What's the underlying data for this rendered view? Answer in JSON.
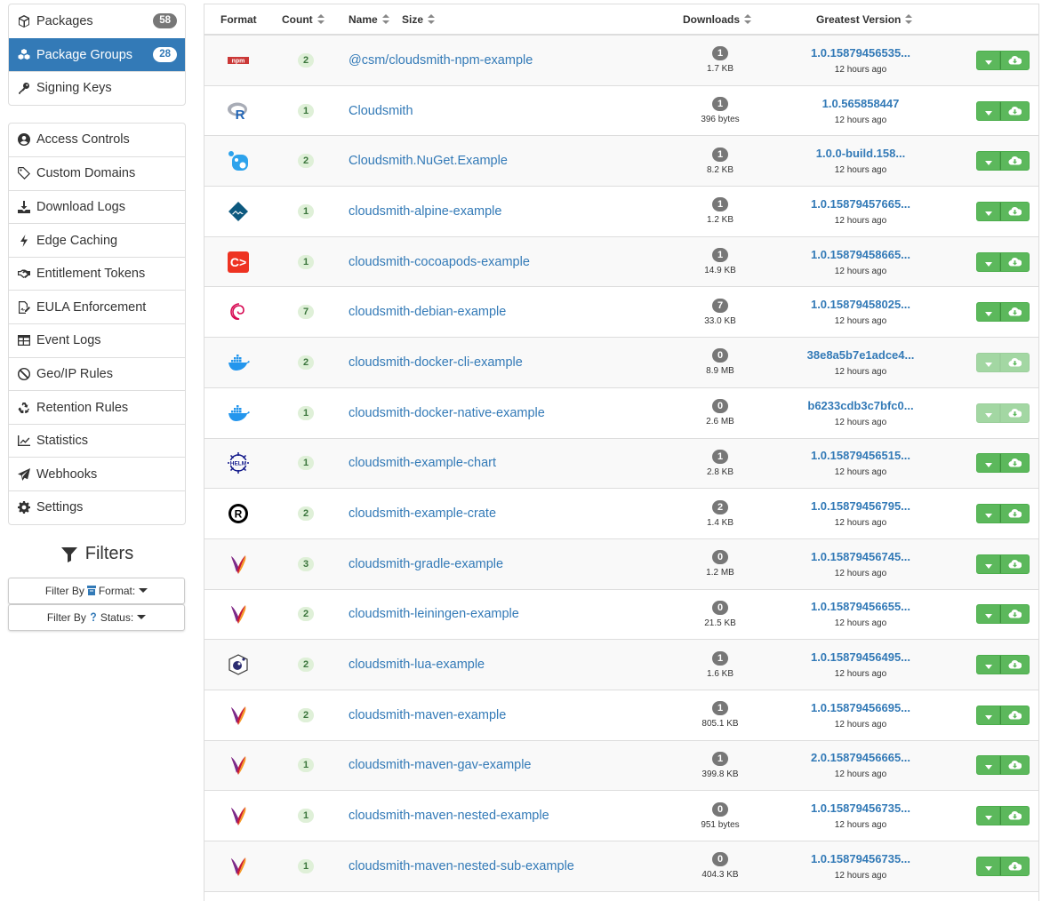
{
  "sidebar": {
    "top": [
      {
        "label": "Packages",
        "badge": "58",
        "icon": "cube-icon",
        "active": false
      },
      {
        "label": "Package Groups",
        "badge": "28",
        "icon": "cubes-icon",
        "active": true
      },
      {
        "label": "Signing Keys",
        "badge": "",
        "icon": "key-icon",
        "active": false
      }
    ],
    "settings": [
      {
        "label": "Access Controls",
        "icon": "user-circle-icon"
      },
      {
        "label": "Custom Domains",
        "icon": "tag-icon"
      },
      {
        "label": "Download Logs",
        "icon": "download-icon"
      },
      {
        "label": "Edge Caching",
        "icon": "bolt-icon"
      },
      {
        "label": "Entitlement Tokens",
        "icon": "handshake-icon"
      },
      {
        "label": "EULA Enforcement",
        "icon": "file-signature-icon"
      },
      {
        "label": "Event Logs",
        "icon": "table-icon"
      },
      {
        "label": "Geo/IP Rules",
        "icon": "ban-icon"
      },
      {
        "label": "Retention Rules",
        "icon": "recycle-icon"
      },
      {
        "label": "Statistics",
        "icon": "chart-line-icon"
      },
      {
        "label": "Webhooks",
        "icon": "paper-plane-icon"
      },
      {
        "label": "Settings",
        "icon": "gear-icon"
      }
    ],
    "filters": {
      "title": "Filters",
      "format": {
        "prefix": "Filter By",
        "label": "Format:"
      },
      "status": {
        "prefix": "Filter By",
        "label": "Status:"
      }
    }
  },
  "table": {
    "headers": {
      "format": "Format",
      "count": "Count",
      "name": "Name",
      "size": "Size",
      "downloads": "Downloads",
      "version": "Greatest Version"
    },
    "rows": [
      {
        "format": "npm",
        "count": "2",
        "name": "@csm/cloudsmith-npm-example",
        "downloads": "1",
        "size": "1.7 KB",
        "version": "1.0.15879456535...",
        "time": "12 hours ago",
        "enabled": true
      },
      {
        "format": "r",
        "count": "1",
        "name": "Cloudsmith",
        "downloads": "1",
        "size": "396 bytes",
        "version": "1.0.565858447",
        "time": "12 hours ago",
        "enabled": true
      },
      {
        "format": "nuget",
        "count": "2",
        "name": "Cloudsmith.NuGet.Example",
        "downloads": "1",
        "size": "8.2 KB",
        "version": "1.0.0-build.158...",
        "time": "12 hours ago",
        "enabled": true
      },
      {
        "format": "alpine",
        "count": "1",
        "name": "cloudsmith-alpine-example",
        "downloads": "1",
        "size": "1.2 KB",
        "version": "1.0.15879457665...",
        "time": "12 hours ago",
        "enabled": true
      },
      {
        "format": "cocoapods",
        "count": "1",
        "name": "cloudsmith-cocoapods-example",
        "downloads": "1",
        "size": "14.9 KB",
        "version": "1.0.15879458665...",
        "time": "12 hours ago",
        "enabled": true
      },
      {
        "format": "debian",
        "count": "7",
        "name": "cloudsmith-debian-example",
        "downloads": "7",
        "size": "33.0 KB",
        "version": "1.0.15879458025...",
        "time": "12 hours ago",
        "enabled": true
      },
      {
        "format": "docker",
        "count": "2",
        "name": "cloudsmith-docker-cli-example",
        "downloads": "0",
        "size": "8.9 MB",
        "version": "38e8a5b7e1adce4...",
        "time": "12 hours ago",
        "enabled": false
      },
      {
        "format": "docker",
        "count": "1",
        "name": "cloudsmith-docker-native-example",
        "downloads": "0",
        "size": "2.6 MB",
        "version": "b6233cdb3c7bfc0...",
        "time": "12 hours ago",
        "enabled": false
      },
      {
        "format": "helm",
        "count": "1",
        "name": "cloudsmith-example-chart",
        "downloads": "1",
        "size": "2.8 KB",
        "version": "1.0.15879456515...",
        "time": "12 hours ago",
        "enabled": true
      },
      {
        "format": "cargo",
        "count": "2",
        "name": "cloudsmith-example-crate",
        "downloads": "2",
        "size": "1.4 KB",
        "version": "1.0.15879456795...",
        "time": "12 hours ago",
        "enabled": true
      },
      {
        "format": "maven",
        "count": "3",
        "name": "cloudsmith-gradle-example",
        "downloads": "0",
        "size": "1.2 MB",
        "version": "1.0.15879456745...",
        "time": "12 hours ago",
        "enabled": true
      },
      {
        "format": "maven",
        "count": "2",
        "name": "cloudsmith-leiningen-example",
        "downloads": "0",
        "size": "21.5 KB",
        "version": "1.0.15879456655...",
        "time": "12 hours ago",
        "enabled": true
      },
      {
        "format": "luarocks",
        "count": "2",
        "name": "cloudsmith-lua-example",
        "downloads": "1",
        "size": "1.6 KB",
        "version": "1.0.15879456495...",
        "time": "12 hours ago",
        "enabled": true
      },
      {
        "format": "maven",
        "count": "2",
        "name": "cloudsmith-maven-example",
        "downloads": "1",
        "size": "805.1 KB",
        "version": "1.0.15879456695...",
        "time": "12 hours ago",
        "enabled": true
      },
      {
        "format": "maven",
        "count": "1",
        "name": "cloudsmith-maven-gav-example",
        "downloads": "1",
        "size": "399.8 KB",
        "version": "2.0.15879456665...",
        "time": "12 hours ago",
        "enabled": true
      },
      {
        "format": "maven",
        "count": "1",
        "name": "cloudsmith-maven-nested-example",
        "downloads": "0",
        "size": "951 bytes",
        "version": "1.0.15879456735...",
        "time": "12 hours ago",
        "enabled": true
      },
      {
        "format": "maven",
        "count": "1",
        "name": "cloudsmith-maven-nested-sub-example",
        "downloads": "0",
        "size": "404.3 KB",
        "version": "1.0.15879456735...",
        "time": "12 hours ago",
        "enabled": true
      }
    ]
  },
  "colors": {
    "accent": "#337ab7",
    "success": "#5cb85c",
    "badge": "#777777"
  }
}
